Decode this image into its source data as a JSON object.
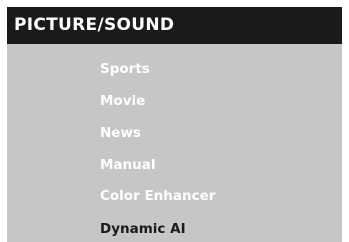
{
  "menu": {
    "title": "PICTURE/SOUND",
    "items": [
      {
        "label": "Sports"
      },
      {
        "label": "Movie"
      },
      {
        "label": "News"
      },
      {
        "label": "Manual"
      },
      {
        "label": "Color Enhancer"
      },
      {
        "label": "Dynamic AI",
        "selected": true
      }
    ]
  },
  "colors": {
    "header_background": "#1a1a1a",
    "panel_background": "#c6c6c6",
    "item_text": "#ffffff",
    "selected_item_text": "#1a1a1a"
  }
}
